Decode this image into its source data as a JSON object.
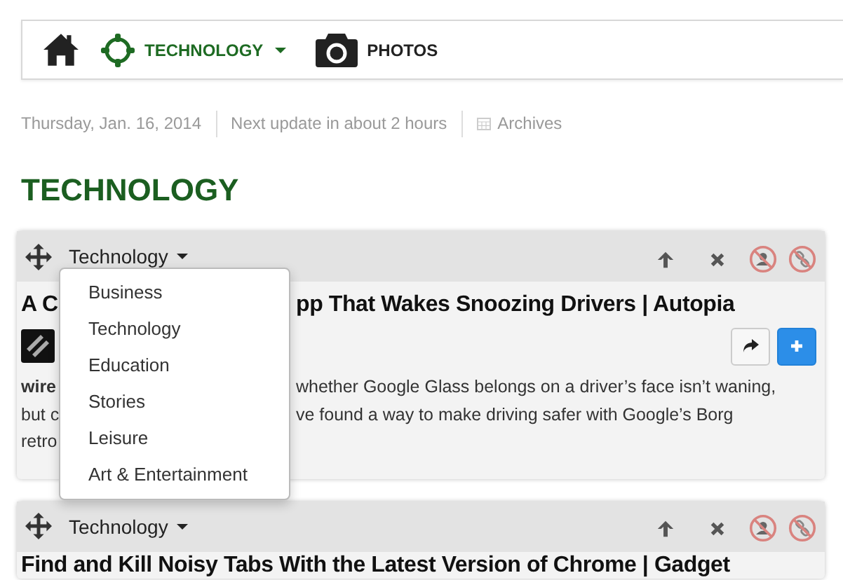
{
  "nav": {
    "items": [
      {
        "kind": "home"
      },
      {
        "kind": "category",
        "label": "TECHNOLOGY",
        "selected": true
      },
      {
        "kind": "photos",
        "label": "PHOTOS",
        "selected": false
      }
    ]
  },
  "meta": {
    "date": "Thursday, Jan. 16, 2014",
    "update": "Next update in about 2 hours",
    "archives": "Archives"
  },
  "heading": "TECHNOLOGY",
  "cards": [
    {
      "category": "Technology",
      "title_parts": [
        "A C",
        "pp That Wakes Snoozing Drivers | Autopia"
      ],
      "body_lines": [
        {
          "left": "wire",
          "left_bold": true,
          "right": "whether Google Glass belongs on a driver’s face isn’t waning,"
        },
        {
          "left": "but c",
          "left_bold": false,
          "right": "ve found a way to make driving safer with Google’s Borg"
        },
        {
          "left": "retro",
          "left_bold": false
        }
      ]
    },
    {
      "category": "Technology",
      "title_parts": [
        "Find and Kill Noisy Tabs With the Latest Version of Chrome | Gadget"
      ]
    }
  ],
  "dropdown": {
    "items": [
      "Business",
      "Technology",
      "Education",
      "Stories",
      "Leisure",
      "Art & Entertainment"
    ]
  }
}
